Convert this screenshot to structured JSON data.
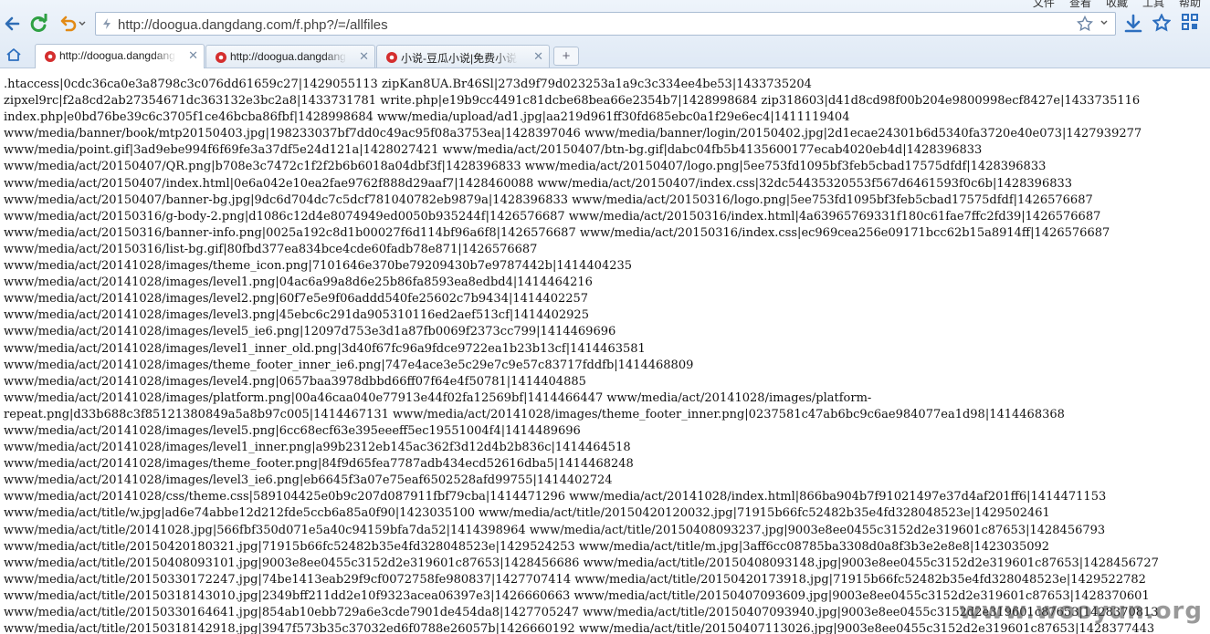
{
  "menu": [
    "文件",
    "查看",
    "收藏",
    "工具",
    "帮助"
  ],
  "address_bar": {
    "url": "http://doogua.dangdang.com/f.php?/=/allfiles"
  },
  "tabs": [
    {
      "label": "http://doogua.dangdang.com/f.php?/=/allfiles",
      "active": true
    },
    {
      "label": "http://doogua.dangdang.com/f.php?/=/allfiles",
      "active": false
    },
    {
      "label": "小说-豆瓜小说|免费小说",
      "active": false
    }
  ],
  "new_tab_label": "+",
  "watermark": "www.wooyun.org",
  "listing_lines": [
    ".htaccess|0cdc36ca0e3a8798c3c076dd61659c27|1429055113 zipKan8UA.Br46Sl|273d9f79d023253a1a9c3c334ee4be53|1433735204",
    "zipxel9rc|f2a8cd2ab27354671dc363132e3bc2a8|1433731781 write.php|e19b9cc4491c81dcbe68bea66e2354b7|1428998684 zip318603|d41d8cd98f00b204e9800998ecf8427e|1433735116",
    "index.php|e0bd76be39c6c3705f1ce46bcba86fbf|1428998684 www/media/upload/ad1.jpg|aa219d961ff30fd685ebc0a1f29e6ec4|1411119404",
    "www/media/banner/book/mtp20150403.jpg|198233037bf7dd0c49ac95f08a3753ea|1428397046 www/media/banner/login/20150402.jpg|2d1ecae24301b6d5340fa3720e40e073|1427939277",
    "www/media/point.gif|3ad9ebe994f6f69fe3a37df5e24d121a|1428027421 www/media/act/20150407/btn-bg.gif|dabc04fb5b4135600177ecab4020eb4d|1428396833",
    "www/media/act/20150407/QR.png|b708e3c7472c1f2f2b6b6018a04dbf3f|1428396833 www/media/act/20150407/logo.png|5ee753fd1095bf3feb5cbad17575dfdf|1428396833",
    "www/media/act/20150407/index.html|0e6a042e10ea2fae9762f888d29aaf7|1428460088 www/media/act/20150407/index.css|32dc54435320553f567d6461593f0c6b|1428396833",
    "www/media/act/20150407/banner-bg.jpg|9dc6d704dc7c5dcf781040782eb9879a|1428396833 www/media/act/20150316/logo.png|5ee753fd1095bf3feb5cbad17575dfdf|1426576687",
    "www/media/act/20150316/g-body-2.png|d1086c12d4e8074949ed0050b935244f|1426576687 www/media/act/20150316/index.html|4a63965769331f180c61fae7ffc2fd39|1426576687",
    "www/media/act/20150316/banner-info.png|0025a192c8d1b00027f6d114bf96a6f8|1426576687 www/media/act/20150316/index.css|ec969cea256e09171bcc62b15a8914ff|1426576687",
    "www/media/act/20150316/list-bg.gif|80fbd377ea834bce4cde60fadb78e871|1426576687",
    "www/media/act/20141028/images/theme_icon.png|7101646e370be79209430b7e9787442b|1414404235",
    "www/media/act/20141028/images/level1.png|04ac6a99a8d6e25b86fa8593ea8edbd4|1414464216",
    "www/media/act/20141028/images/level2.png|60f7e5e9f06addd540fe25602c7b9434|1414402257",
    "www/media/act/20141028/images/level3.png|45ebc6c291da905310116ed2aef513cf|1414402925",
    "www/media/act/20141028/images/level5_ie6.png|12097d753e3d1a87fb0069f2373cc799|1414469696",
    "www/media/act/20141028/images/level1_inner_old.png|3d40f67fc96a9fdce9722ea1b23b13cf|1414463581",
    "www/media/act/20141028/images/theme_footer_inner_ie6.png|747e4ace3e5c29e7c9e57c83717fddfb|1414468809",
    "www/media/act/20141028/images/level4.png|0657baa3978dbbd66ff07f64e4f50781|1414404885",
    "www/media/act/20141028/images/platform.png|00a46caa040e77913e44f02fa12569bf|1414466447 www/media/act/20141028/images/platform-",
    "repeat.png|d33b688c3f85121380849a5a8b97c005|1414467131 www/media/act/20141028/images/theme_footer_inner.png|0237581c47ab6bc9c6ae984077ea1d98|1414468368",
    "www/media/act/20141028/images/level5.png|6cc68ecf63e395eeeff5ec19551004f4|1414489696",
    "www/media/act/20141028/images/level1_inner.png|a99b2312eb145ac362f3d12d4b2b836c|1414464518",
    "www/media/act/20141028/images/theme_footer.png|84f9d65fea7787adb434ecd52616dba5|1414468248",
    "www/media/act/20141028/images/level3_ie6.png|eb6645f3a07e75eaf6502528afd99755|1414402724",
    "www/media/act/20141028/css/theme.css|589104425e0b9c207d087911fbf79cba|1414471296 www/media/act/20141028/index.html|866ba904b7f91021497e37d4af201ff6|1414471153",
    "www/media/act/title/w.jpg|ad6e74abbe12d212fde5ccb6a85a0f90|1423035100 www/media/act/title/20150420120032.jpg|71915b66fc52482b35e4fd328048523e|1429502461",
    "www/media/act/title/20141028.jpg|566fbf350d071e5a40c94159bfa7da52|1414398964 www/media/act/title/20150408093237.jpg|9003e8ee0455c3152d2e319601c87653|1428456793",
    "www/media/act/title/20150420180321.jpg|71915b66fc52482b35e4fd328048523e|1429524253 www/media/act/title/m.jpg|3aff6cc08785ba3308d0a8f3b3e2e8e8|1423035092",
    "www/media/act/title/20150408093101.jpg|9003e8ee0455c3152d2e319601c87653|1428456686 www/media/act/title/20150408093148.jpg|9003e8ee0455c3152d2e319601c87653|1428456727",
    "www/media/act/title/20150330172247.jpg|74be1413eab29f9cf0072758fe980837|1427707414 www/media/act/title/20150420173918.jpg|71915b66fc52482b35e4fd328048523e|1429522782",
    "www/media/act/title/20150318143010.jpg|2349bff211dd2e10f9323acea06397e3|1426660663 www/media/act/title/20150407093609.jpg|9003e8ee0455c3152d2e319601c87653|1428370601",
    "www/media/act/title/20150330164641.jpg|854ab10ebb729a6e3cde7901de454da8|1427705247 www/media/act/title/20150407093940.jpg|9003e8ee0455c3152d2e319601c87653|1428370813",
    "www/media/act/title/20150318142918.jpg|3947f573b35c37032ed6f0788e26057b|1426660192 www/media/act/title/20150407113026.jpg|9003e8ee0455c3152d2e319601c87653|1428377443"
  ]
}
